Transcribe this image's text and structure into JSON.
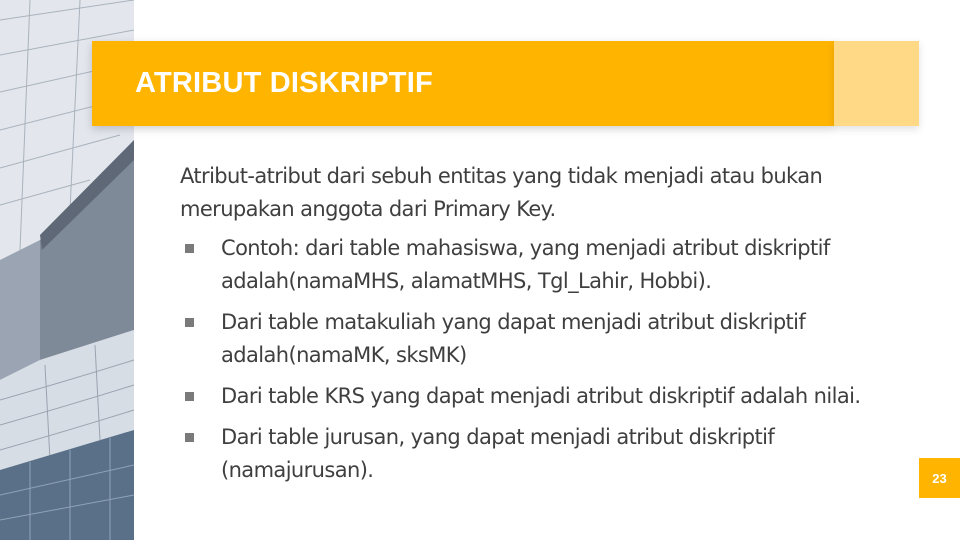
{
  "slide": {
    "title": "ATRIBUT DISKRIPTIF",
    "intro": "Atribut-atribut dari sebuh entitas yang tidak menjadi atau bukan merupakan anggota dari Primary Key.",
    "bullets": [
      {
        "text": "Contoh: dari table mahasiswa, yang menjadi atribut diskriptif adalah(namaMHS, alamatMHS, Tgl_Lahir, Hobbi)."
      },
      {
        "text": "Dari table matakuliah  yang dapat menjadi atribut diskriptif adalah(namaMK, sksMK)"
      },
      {
        "text": "Dari table KRS yang dapat menjadi atribut diskriptif adalah nilai."
      },
      {
        "text": "Dari table jurusan, yang dapat menjadi atribut diskriptif (namajurusan)."
      }
    ],
    "page_number": "23",
    "bullet_icon": "square-bullet-icon"
  },
  "colors": {
    "accent": "#FFB400",
    "accent_light": "#FFD985",
    "text": "#3f3f3f",
    "bullet": "#7a7a7a"
  }
}
